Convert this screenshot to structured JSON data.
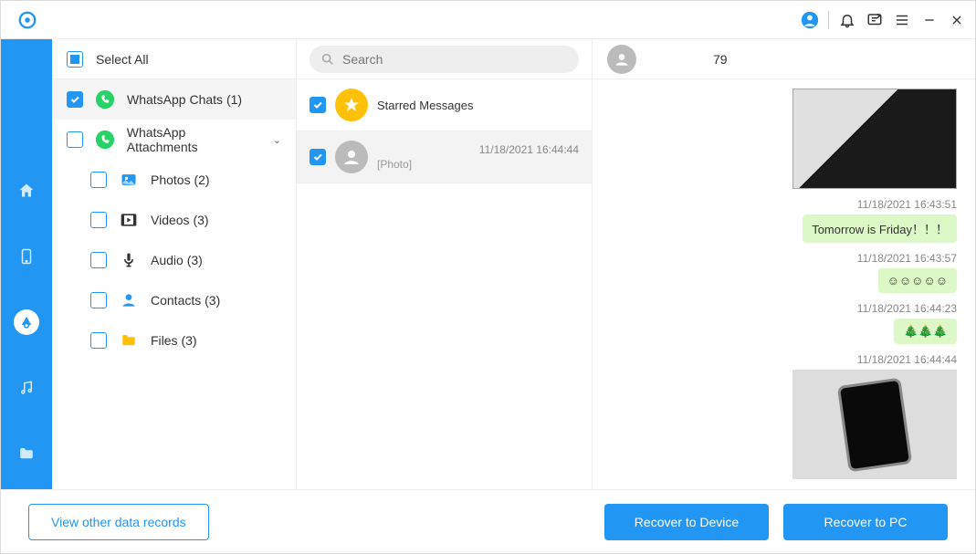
{
  "titlebar": {},
  "sidebar": {
    "select_all_label": "Select All",
    "cats": [
      {
        "label": "WhatsApp Chats (1)"
      },
      {
        "label": "WhatsApp Attachments"
      },
      {
        "label": "Photos (2)"
      },
      {
        "label": "Videos (3)"
      },
      {
        "label": "Audio (3)"
      },
      {
        "label": "Contacts (3)"
      },
      {
        "label": "Files (3)"
      }
    ]
  },
  "search": {
    "placeholder": "Search"
  },
  "chatlist": {
    "items": [
      {
        "title": "Starred Messages"
      },
      {
        "name": "",
        "date": "11/18/2021 16:44:44",
        "preview": "[Photo]"
      }
    ]
  },
  "conv": {
    "header_suffix": "79",
    "messages": [
      {
        "time": "11/18/2021 16:43:51",
        "text": "Tomorrow is Friday！！！",
        "type": "text"
      },
      {
        "time": "11/18/2021 16:43:57",
        "text": "☺☺☺☺☺",
        "type": "text"
      },
      {
        "time": "11/18/2021 16:44:23",
        "text": "🎄🎄🎄",
        "type": "text"
      },
      {
        "time": "11/18/2021 16:44:44",
        "type": "photo2"
      }
    ],
    "top_photo_type": "photo1"
  },
  "footer": {
    "view_other": "View other data records",
    "recover_device": "Recover to Device",
    "recover_pc": "Recover to PC"
  }
}
